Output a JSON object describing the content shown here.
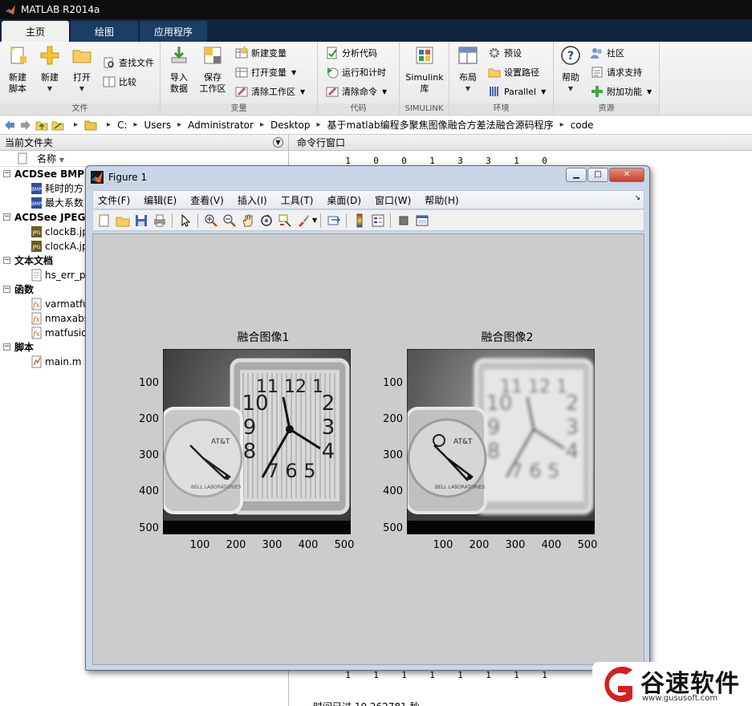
{
  "app": {
    "title": "MATLAB R2014a"
  },
  "tabs": [
    {
      "label": "主页"
    },
    {
      "label": "绘图"
    },
    {
      "label": "应用程序"
    }
  ],
  "ribbon": {
    "file": {
      "new_script": [
        "新建",
        "脚本"
      ],
      "new": "新建",
      "open": "打开",
      "find_files": "查找文件",
      "compare": "比较",
      "group_label": "文件"
    },
    "variable": {
      "import": [
        "导入",
        "数据"
      ],
      "save_ws": [
        "保存",
        "工作区"
      ],
      "new_var": "新建变量",
      "open_var": "打开变量",
      "clear_ws": "清除工作区",
      "group_label": "变量"
    },
    "code": {
      "analyze": "分析代码",
      "run_time": "运行和计时",
      "clear_cmd": "清除命令",
      "group_label": "代码"
    },
    "simulink": {
      "lib": [
        "Simulink",
        "库"
      ],
      "group_label": "SIMULINK"
    },
    "env": {
      "layout": "布局",
      "prefs": "预设",
      "set_path": "设置路径",
      "parallel": "Parallel",
      "group_label": "环境"
    },
    "resources": {
      "help": "帮助",
      "community": "社区",
      "request_support": "请求支持",
      "addons": "附加功能",
      "group_label": "资源"
    }
  },
  "address": {
    "crumbs": [
      "C:",
      "Users",
      "Administrator",
      "Desktop",
      "基于matlab编程多聚焦图像融合方差法融合源码程序",
      "code"
    ]
  },
  "left_panel": {
    "title": "当前文件夹",
    "column": "名称",
    "tree": [
      {
        "type": "cat",
        "label": "ACDSee BMP 图"
      },
      {
        "type": "file",
        "label": "耗时的方",
        "icon": "bmp-icon"
      },
      {
        "type": "file",
        "label": "最大系数",
        "icon": "bmp-icon"
      },
      {
        "type": "cat",
        "label": "ACDSee JPEG"
      },
      {
        "type": "file",
        "label": "clockB.jpg",
        "icon": "jpg-icon"
      },
      {
        "type": "file",
        "label": "clockA.jpg",
        "icon": "jpg-icon"
      },
      {
        "type": "cat",
        "label": "文本文档"
      },
      {
        "type": "file",
        "label": "hs_err_p",
        "icon": "text-file-icon"
      },
      {
        "type": "cat",
        "label": "函数"
      },
      {
        "type": "file",
        "label": "varmatfu",
        "icon": "function-file-icon"
      },
      {
        "type": "file",
        "label": "nmaxabs",
        "icon": "function-file-icon"
      },
      {
        "type": "file",
        "label": "matfusio",
        "icon": "function-file-icon"
      },
      {
        "type": "cat",
        "label": "脚本"
      },
      {
        "type": "file",
        "label": "main.m",
        "icon": "script-file-icon"
      }
    ]
  },
  "command_window": {
    "title": "命令行窗口",
    "top_row": [
      "1",
      "0",
      "0",
      "1",
      "3",
      "3",
      "1",
      "0"
    ],
    "bottom_row": [
      "1",
      "1",
      "1",
      "1",
      "1",
      "1",
      "1",
      "1"
    ],
    "elapsed_text": "时间已过 10.262781 秒。"
  },
  "figure": {
    "title": "Figure 1",
    "menu": [
      "文件(F)",
      "编辑(E)",
      "查看(V)",
      "插入(I)",
      "工具(T)",
      "桌面(D)",
      "窗口(W)",
      "帮助(H)"
    ],
    "axes": [
      {
        "title": "融合图像1"
      },
      {
        "title": "融合图像2"
      }
    ],
    "yticks": [
      "100",
      "200",
      "300",
      "400",
      "500"
    ],
    "xticks": [
      "100",
      "200",
      "300",
      "400",
      "500"
    ]
  },
  "watermark": {
    "text": "谷速软件",
    "url": "www.gususoft.com"
  }
}
